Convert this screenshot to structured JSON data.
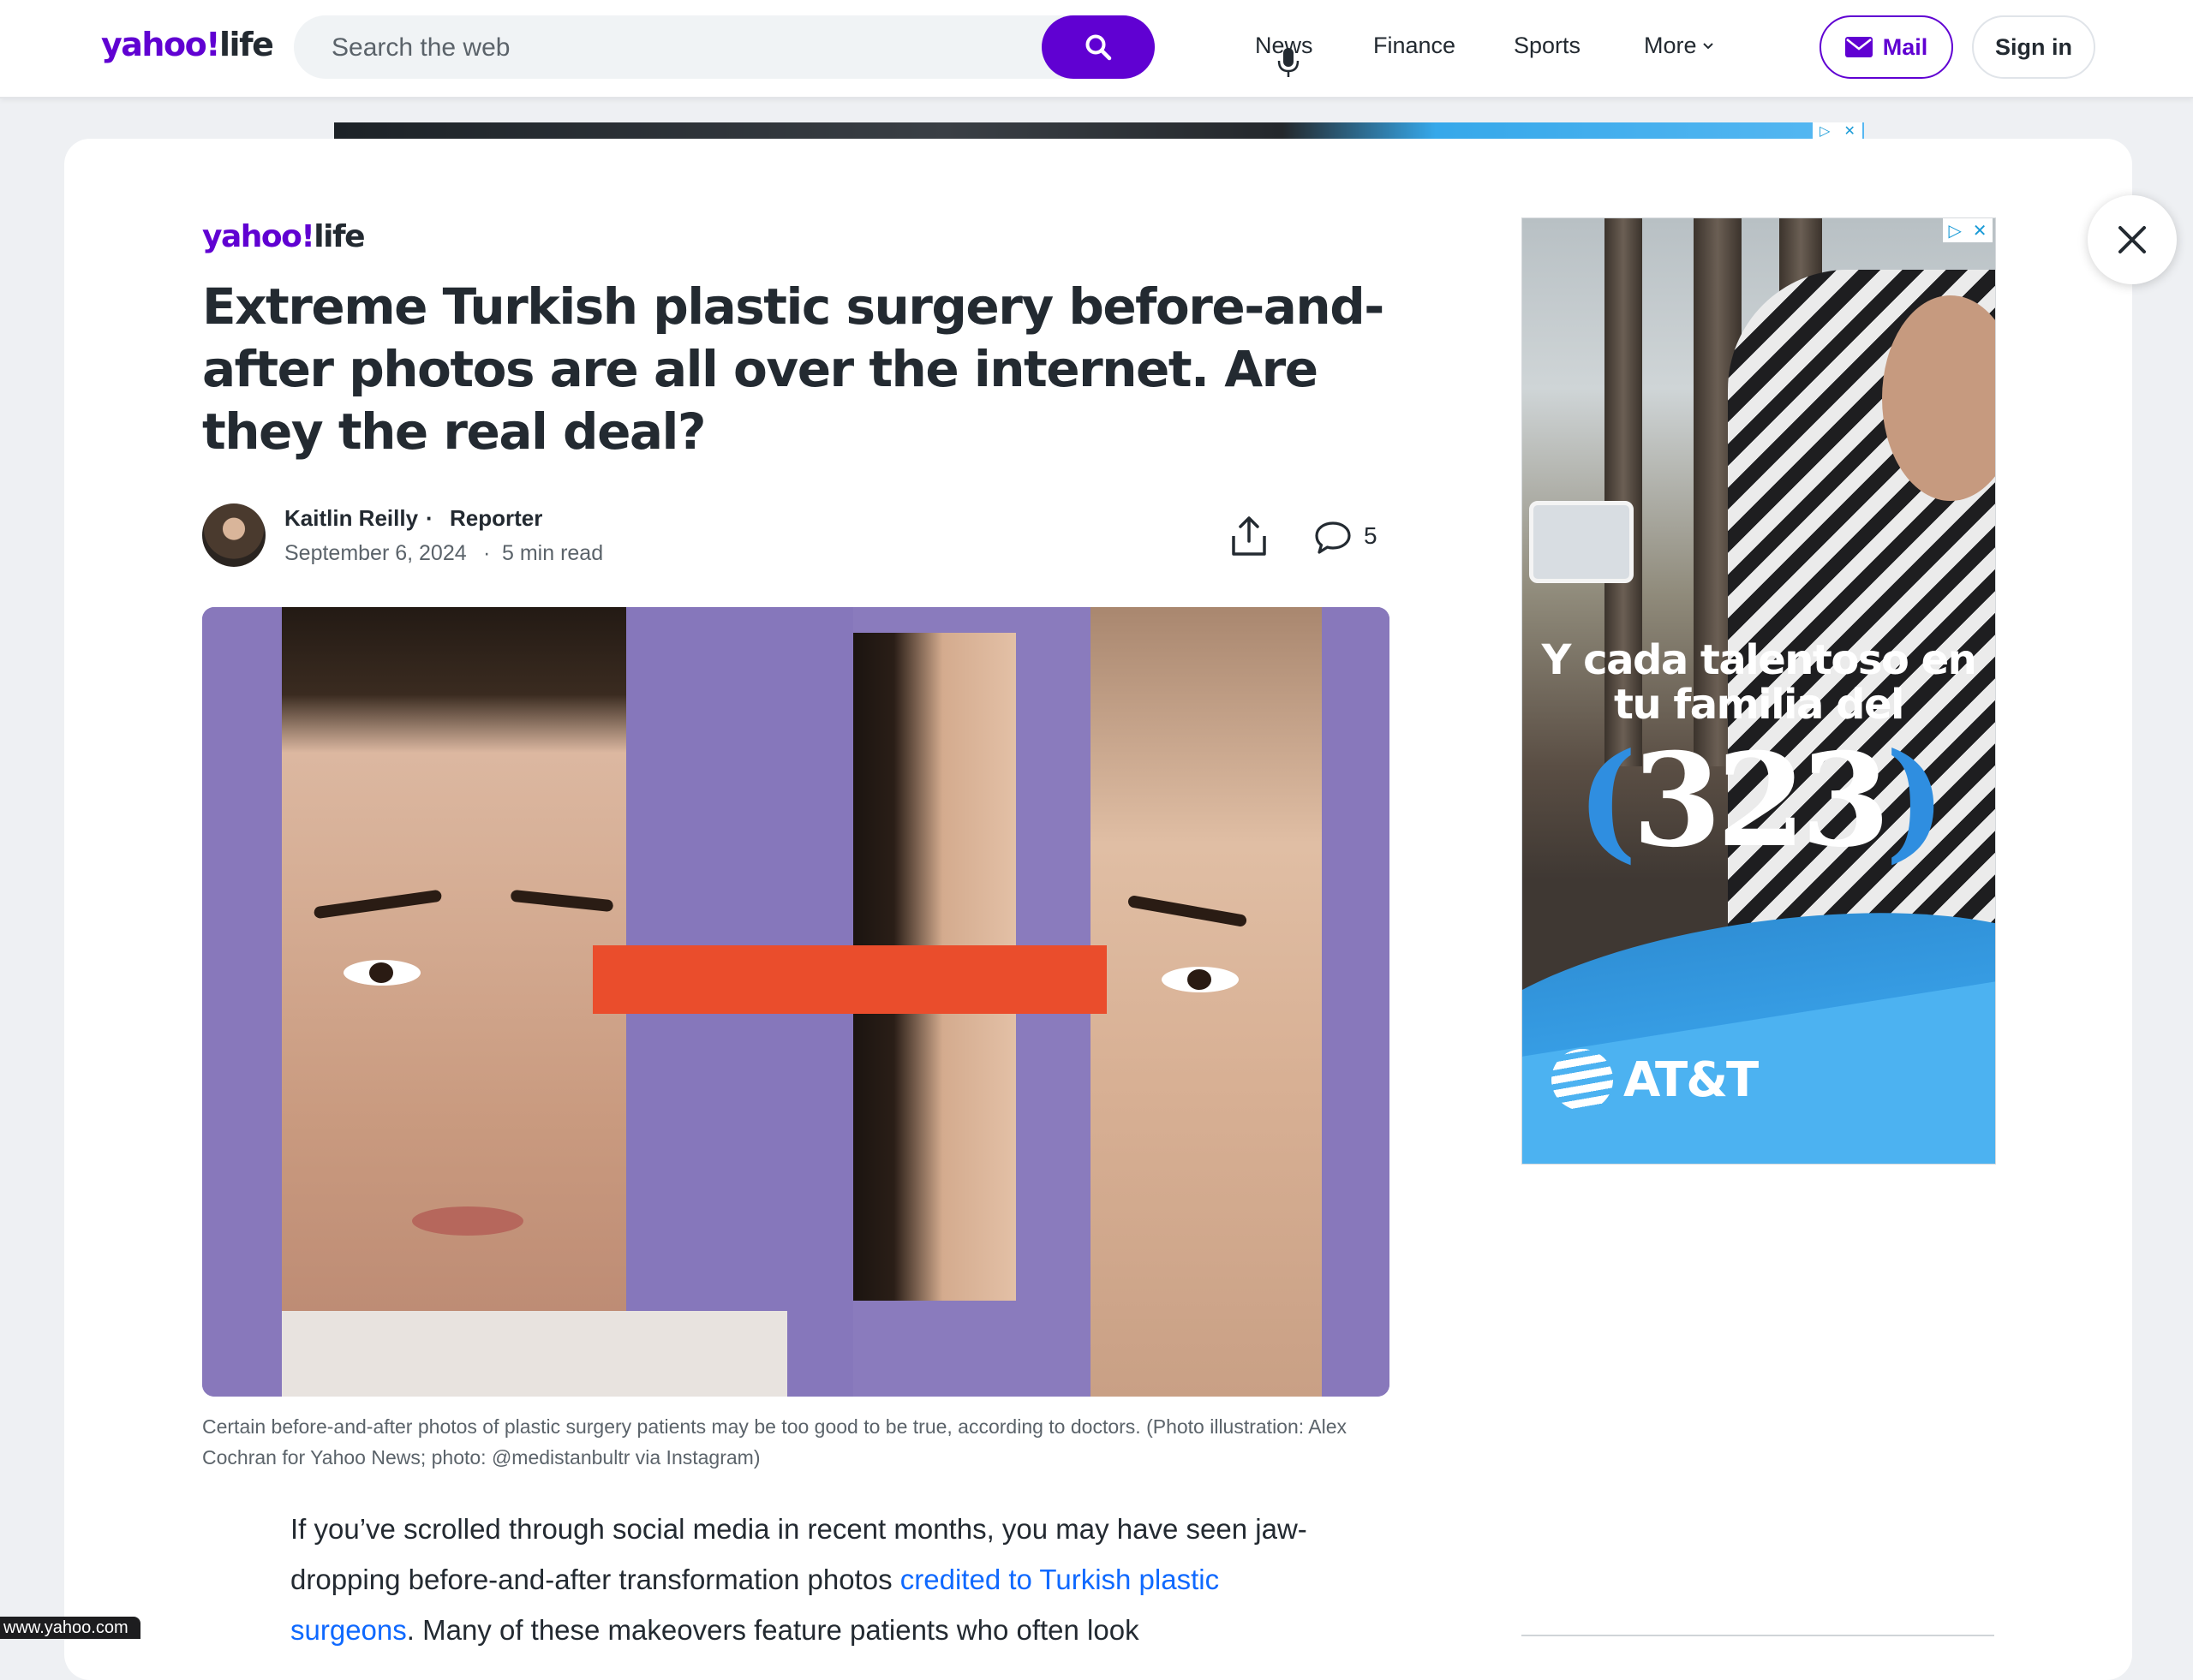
{
  "header": {
    "logo": {
      "brand": "yahoo!",
      "sub": "life"
    },
    "search_placeholder": "Search the web",
    "nav": [
      "News",
      "Finance",
      "Sports",
      "More"
    ],
    "mail_label": "Mail",
    "signin_label": "Sign in"
  },
  "article": {
    "logo": {
      "brand": "yahoo!",
      "sub": "life"
    },
    "title": "Extreme Turkish plastic surgery before-and-after photos are all over the internet. Are they the real deal?",
    "author": "Kaitlin Reilly",
    "separator": "·",
    "role": "Reporter",
    "date": "September 6, 2024",
    "read_time": "5 min read",
    "comment_count": "5",
    "caption": "Certain before-and-after photos of plastic surgery patients may be too good to be true, according to doctors. (Photo illustration: Alex Cochran for Yahoo News; photo: @medistanbultr via Instagram)",
    "body": {
      "p1_before": "If you’ve scrolled through social media in recent months, you may have seen jaw-dropping before-and-after transformation photos ",
      "p1_link": "credited to Turkish plastic surgeons",
      "p1_after": ". Many of these makeovers feature patients who often look"
    }
  },
  "ad": {
    "text": "Y cada talentoso en tu familia del",
    "paren_open": "(",
    "number": "323",
    "paren_close": ")",
    "brand": "AT&T",
    "choices_label": "▷",
    "choices_close": "✕"
  },
  "status_url": "www.yahoo.com",
  "colors": {
    "brand_purple": "#6001d2",
    "link_blue": "#0f69ff",
    "ad_red": "#ea4d2c",
    "hero_purple": "#8878bb"
  }
}
